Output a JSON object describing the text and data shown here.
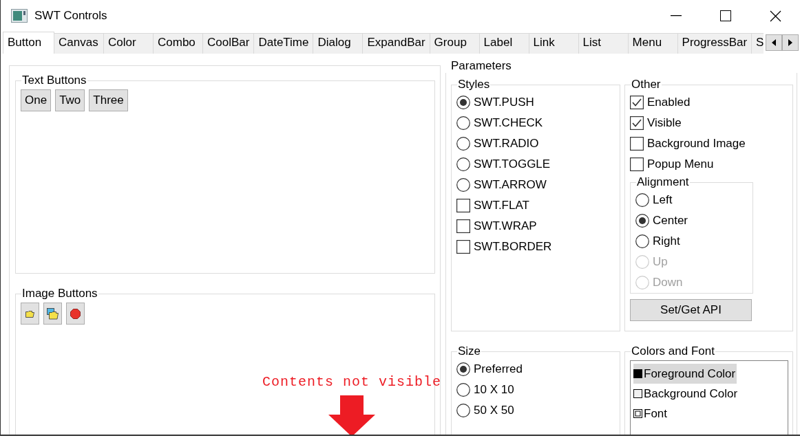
{
  "window": {
    "title": "SWT Controls"
  },
  "tabs": [
    {
      "label": "Button",
      "selected": true
    },
    {
      "label": "Canvas",
      "selected": false
    },
    {
      "label": "Color",
      "selected": false
    },
    {
      "label": "Combo",
      "selected": false
    },
    {
      "label": "CoolBar",
      "selected": false
    },
    {
      "label": "DateTime",
      "selected": false
    },
    {
      "label": "Dialog",
      "selected": false
    },
    {
      "label": "ExpandBar",
      "selected": false
    },
    {
      "label": "Group",
      "selected": false
    },
    {
      "label": "Label",
      "selected": false
    },
    {
      "label": "Link",
      "selected": false
    },
    {
      "label": "List",
      "selected": false
    },
    {
      "label": "Menu",
      "selected": false
    },
    {
      "label": "ProgressBar",
      "selected": false
    },
    {
      "label": "S",
      "selected": false
    }
  ],
  "text_buttons": {
    "title": "Text Buttons",
    "buttons": [
      "One",
      "Two",
      "Three"
    ]
  },
  "image_buttons": {
    "title": "Image Buttons"
  },
  "parameters": {
    "title": "Parameters",
    "styles": {
      "title": "Styles",
      "items": [
        {
          "kind": "radio",
          "label": "SWT.PUSH",
          "checked": true
        },
        {
          "kind": "radio",
          "label": "SWT.CHECK",
          "checked": false
        },
        {
          "kind": "radio",
          "label": "SWT.RADIO",
          "checked": false
        },
        {
          "kind": "radio",
          "label": "SWT.TOGGLE",
          "checked": false
        },
        {
          "kind": "radio",
          "label": "SWT.ARROW",
          "checked": false
        },
        {
          "kind": "checkbox",
          "label": "SWT.FLAT",
          "checked": false
        },
        {
          "kind": "checkbox",
          "label": "SWT.WRAP",
          "checked": false
        },
        {
          "kind": "checkbox",
          "label": "SWT.BORDER",
          "checked": false
        }
      ]
    },
    "other": {
      "title": "Other",
      "items": [
        {
          "kind": "checkbox",
          "label": "Enabled",
          "checked": true
        },
        {
          "kind": "checkbox",
          "label": "Visible",
          "checked": true
        },
        {
          "kind": "checkbox",
          "label": "Background Image",
          "checked": false
        },
        {
          "kind": "checkbox",
          "label": "Popup Menu",
          "checked": false
        }
      ],
      "alignment": {
        "title": "Alignment",
        "items": [
          {
            "label": "Left",
            "checked": false,
            "disabled": false
          },
          {
            "label": "Center",
            "checked": true,
            "disabled": false
          },
          {
            "label": "Right",
            "checked": false,
            "disabled": false
          },
          {
            "label": "Up",
            "checked": false,
            "disabled": true
          },
          {
            "label": "Down",
            "checked": false,
            "disabled": true
          }
        ]
      },
      "button": "Set/Get API"
    },
    "size": {
      "title": "Size",
      "items": [
        {
          "kind": "radio",
          "label": "Preferred",
          "checked": true
        },
        {
          "kind": "radio",
          "label": "10 X 10",
          "checked": false
        },
        {
          "kind": "radio",
          "label": "50 X 50",
          "checked": false
        }
      ]
    },
    "colors_and_font": {
      "title": "Colors and Font",
      "items": [
        {
          "kind": "color",
          "label": "Foreground Color",
          "selected": true,
          "color": "#000000"
        },
        {
          "kind": "color",
          "label": "Background Color",
          "selected": false,
          "color": "#f0f0f0"
        },
        {
          "kind": "font",
          "label": "Font",
          "selected": false
        }
      ]
    }
  },
  "annotation": {
    "text": "Contents not visible"
  }
}
